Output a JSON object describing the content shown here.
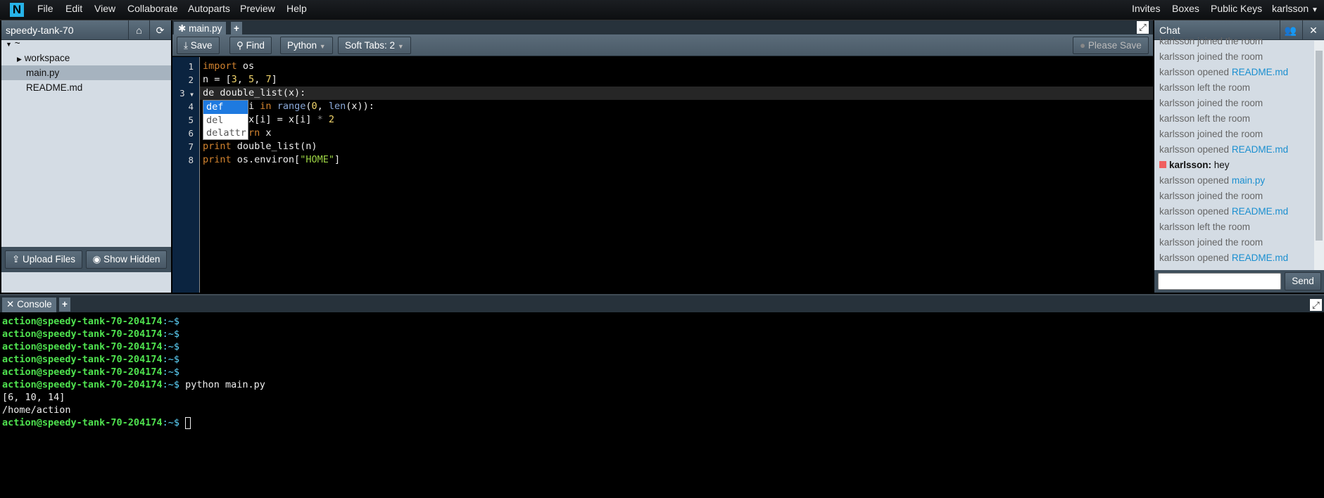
{
  "menubar": {
    "logo": "N",
    "items": [
      "File",
      "Edit",
      "View",
      "Collaborate",
      "Autoparts",
      "Preview",
      "Help"
    ],
    "right": [
      "Invites",
      "Boxes",
      "Public Keys",
      "karlsson"
    ]
  },
  "sidebar": {
    "title": "speedy-tank-70",
    "tree": [
      {
        "label": "~",
        "expanded": true
      },
      {
        "label": "workspace",
        "expanded": false
      },
      {
        "label": "main.py",
        "selected": true
      },
      {
        "label": "README.md"
      }
    ],
    "upload": "Upload Files",
    "show_hidden": "Show Hidden"
  },
  "editor": {
    "tab": "main.py",
    "save": "Save",
    "find": "Find",
    "mode": "Python",
    "tabs": "Soft Tabs: 2",
    "please_save": "Please Save",
    "lines": [
      "import os",
      "n = [3, 5, 7]",
      "de double_list(x):",
      "    for i in range(0, len(x)):",
      "        x[i] = x[i] * 2",
      "    return x",
      "print double_list(n)",
      "print os.environ[\"HOME\"]"
    ],
    "autocomplete": [
      "def",
      "del",
      "delattr"
    ]
  },
  "chat": {
    "title": "Chat",
    "send": "Send",
    "messages": [
      {
        "text": "karlsson joined the room"
      },
      {
        "text": "karlsson joined the room"
      },
      {
        "text": "karlsson opened ",
        "link": "README.md"
      },
      {
        "text": "karlsson left the room"
      },
      {
        "text": "karlsson joined the room"
      },
      {
        "text": "karlsson left the room"
      },
      {
        "text": "karlsson joined the room"
      },
      {
        "text": "karlsson opened ",
        "link": "README.md"
      },
      {
        "user": "karlsson:",
        "text": " hey"
      },
      {
        "text": "karlsson opened ",
        "link": "main.py"
      },
      {
        "text": "karlsson joined the room"
      },
      {
        "text": "karlsson opened ",
        "link": "README.md"
      },
      {
        "text": "karlsson left the room"
      },
      {
        "text": "karlsson joined the room"
      },
      {
        "text": "karlsson opened ",
        "link": "README.md"
      }
    ]
  },
  "console": {
    "tab": "Console",
    "prompt": "action@speedy-tank-70-204174",
    "prompt_suffix": ":~$",
    "lines": [
      {
        "prompt": true,
        "cmd": ""
      },
      {
        "prompt": true,
        "cmd": ""
      },
      {
        "prompt": true,
        "cmd": ""
      },
      {
        "prompt": true,
        "cmd": ""
      },
      {
        "prompt": true,
        "cmd": ""
      },
      {
        "prompt": true,
        "cmd": " python main.py"
      },
      {
        "out": "[6, 10, 14]"
      },
      {
        "out": "/home/action"
      },
      {
        "prompt": true,
        "cmd": " ",
        "cursor": true
      }
    ]
  },
  "colors": {
    "accent": "#27b3e8",
    "prompt": "#4fe24f",
    "link": "#1a8fd0",
    "selection": "#1e7ae0"
  }
}
